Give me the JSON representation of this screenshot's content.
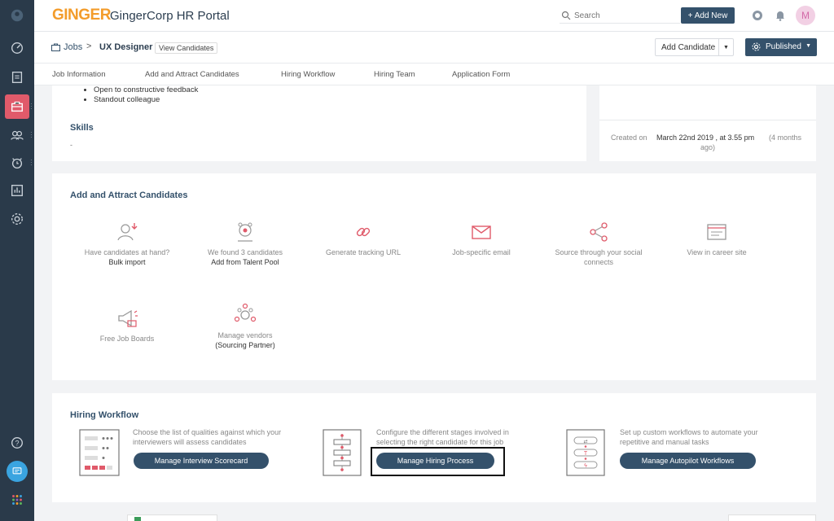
{
  "header": {
    "logo": "GINGER",
    "portal_title": "GingerCorp HR Portal",
    "search_placeholder": "Search",
    "add_new_label": "+ Add New",
    "avatar_initial": "M"
  },
  "breadcrumb": {
    "root": "Jobs",
    "separator": ">",
    "current": "UX Designer",
    "view_candidates": "View Candidates"
  },
  "actions": {
    "add_candidate": "Add Candidate",
    "published": "Published"
  },
  "tabs": [
    "Job Information",
    "Add and Attract Candidates",
    "Hiring Workflow",
    "Hiring Team",
    "Application Form"
  ],
  "job_info": {
    "bullets": [
      "Open to constructive feedback",
      "Standout colleague"
    ],
    "skills_title": "Skills",
    "skills_value": "-",
    "created_label": "Created on",
    "created_value": "March 22nd 2019 , at 3.55 pm",
    "created_ago_1": "(4 months",
    "created_ago_2": "ago)"
  },
  "attract": {
    "title": "Add and Attract Candidates",
    "items": [
      {
        "line1": "Have candidates at hand?",
        "line2": "Bulk import",
        "icon": "bulk-import-icon"
      },
      {
        "line1": "We found 3 candidates",
        "line2": "Add from Talent Pool",
        "icon": "talent-pool-icon"
      },
      {
        "line1": "Generate tracking URL",
        "line2": "",
        "icon": "link-icon"
      },
      {
        "line1": "Job-specific email",
        "line2": "",
        "icon": "mail-icon"
      },
      {
        "line1": "Source through your social",
        "line2": "connects",
        "icon": "share-icon"
      },
      {
        "line1": "View in career site",
        "line2": "",
        "icon": "browser-icon"
      },
      {
        "line1": "Free Job Boards",
        "line2": "",
        "icon": "megaphone-icon"
      },
      {
        "line1": "Manage vendors",
        "line2": "(Sourcing Partner)",
        "icon": "vendors-icon"
      }
    ]
  },
  "workflow": {
    "title": "Hiring Workflow",
    "items": [
      {
        "desc1": "Choose the list of qualities against which your",
        "desc2": "interviewers will assess candidates",
        "button": "Manage Interview Scorecard"
      },
      {
        "desc1": "Configure the different stages involved in",
        "desc2": "selecting the right candidate for this job",
        "button": "Manage Hiring Process"
      },
      {
        "desc1": "Set up custom workflows to automate your",
        "desc2": "repetitive and manual tasks",
        "button": "Manage Autopilot Workflows"
      }
    ]
  },
  "colors": {
    "sidebar": "#2a3a4a",
    "accent_red": "#e05a6a",
    "primary": "#34516b",
    "logo_orange": "#f39c2b"
  }
}
